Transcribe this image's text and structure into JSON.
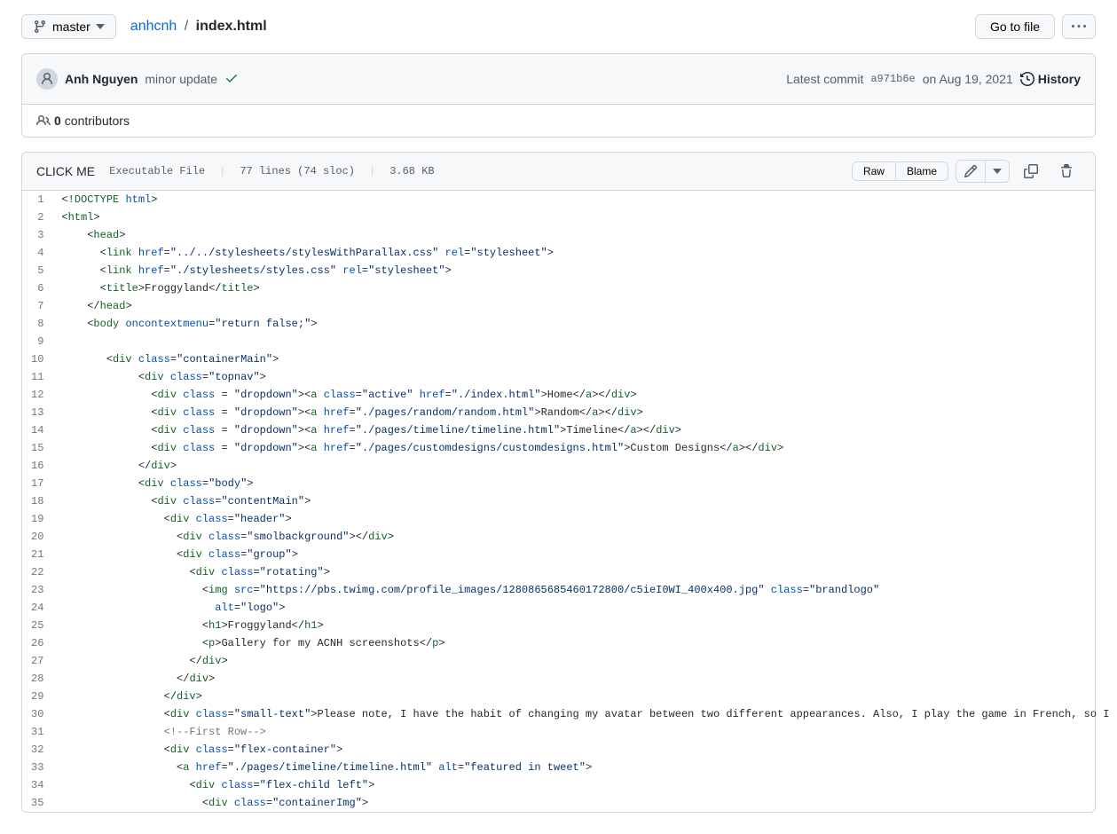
{
  "branch": "master",
  "breadcrumb": {
    "repo": "anhcnh",
    "sep": "/",
    "file": "index.html"
  },
  "go_to_file": "Go to file",
  "commit": {
    "author": "Anh Nguyen",
    "message": "minor update",
    "latest_label": "Latest commit",
    "sha": "a971b6e",
    "date": "on Aug 19, 2021",
    "history": "History"
  },
  "contributors": {
    "count": "0",
    "label": "contributors"
  },
  "file_info": {
    "clickme": "CLICK ME",
    "exec": "Executable File",
    "lines": "77 lines (74 sloc)",
    "size": "3.68 KB"
  },
  "actions": {
    "raw": "Raw",
    "blame": "Blame"
  },
  "code": [
    {
      "n": 1,
      "html": "<span class='pl-kos'>&lt;!</span><span class='pl-ent'>DOCTYPE</span> <span class='pl-e'>html</span><span class='pl-kos'>&gt;</span>"
    },
    {
      "n": 2,
      "html": "<span class='pl-kos'>&lt;</span><span class='pl-ent'>html</span><span class='pl-kos'>&gt;</span>"
    },
    {
      "n": 3,
      "html": "    <span class='pl-kos'>&lt;</span><span class='pl-ent'>head</span><span class='pl-kos'>&gt;</span>"
    },
    {
      "n": 4,
      "html": "      <span class='pl-kos'>&lt;</span><span class='pl-ent'>link</span> <span class='pl-e'>href</span>=<span class='pl-s'>\"../../stylesheets/stylesWithParallax.css\"</span> <span class='pl-e'>rel</span>=<span class='pl-s'>\"stylesheet\"</span><span class='pl-kos'>&gt;</span>"
    },
    {
      "n": 5,
      "html": "      <span class='pl-kos'>&lt;</span><span class='pl-ent'>link</span> <span class='pl-e'>href</span>=<span class='pl-s'>\"./stylesheets/styles.css\"</span> <span class='pl-e'>rel</span>=<span class='pl-s'>\"stylesheet\"</span><span class='pl-kos'>&gt;</span>"
    },
    {
      "n": 6,
      "html": "      <span class='pl-kos'>&lt;</span><span class='pl-ent'>title</span><span class='pl-kos'>&gt;</span>Froggyland<span class='pl-kos'>&lt;/</span><span class='pl-ent'>title</span><span class='pl-kos'>&gt;</span>"
    },
    {
      "n": 7,
      "html": "    <span class='pl-kos'>&lt;/</span><span class='pl-ent'>head</span><span class='pl-kos'>&gt;</span>"
    },
    {
      "n": 8,
      "html": "    <span class='pl-kos'>&lt;</span><span class='pl-ent'>body</span> <span class='pl-e'>oncontextmenu</span>=<span class='pl-s'>\"return false;\"</span><span class='pl-kos'>&gt;</span>"
    },
    {
      "n": 9,
      "html": ""
    },
    {
      "n": 10,
      "html": "       <span class='pl-kos'>&lt;</span><span class='pl-ent'>div</span> <span class='pl-e'>class</span>=<span class='pl-s'>\"containerMain\"</span><span class='pl-kos'>&gt;</span>"
    },
    {
      "n": 11,
      "html": "            <span class='pl-kos'>&lt;</span><span class='pl-ent'>div</span> <span class='pl-e'>class</span>=<span class='pl-s'>\"topnav\"</span><span class='pl-kos'>&gt;</span>"
    },
    {
      "n": 12,
      "html": "              <span class='pl-kos'>&lt;</span><span class='pl-ent'>div</span> <span class='pl-e'>class</span> = <span class='pl-s'>\"dropdown\"</span><span class='pl-kos'>&gt;</span><span class='pl-kos'>&lt;</span><span class='pl-ent'>a</span> <span class='pl-e'>class</span>=<span class='pl-s'>\"active\"</span> <span class='pl-e'>href</span>=<span class='pl-s'>\"./index.html\"</span><span class='pl-kos'>&gt;</span>Home<span class='pl-kos'>&lt;/</span><span class='pl-ent'>a</span><span class='pl-kos'>&gt;</span><span class='pl-kos'>&lt;/</span><span class='pl-ent'>div</span><span class='pl-kos'>&gt;</span>"
    },
    {
      "n": 13,
      "html": "              <span class='pl-kos'>&lt;</span><span class='pl-ent'>div</span> <span class='pl-e'>class</span> = <span class='pl-s'>\"dropdown\"</span><span class='pl-kos'>&gt;</span><span class='pl-kos'>&lt;</span><span class='pl-ent'>a</span> <span class='pl-e'>href</span>=<span class='pl-s'>\"./pages/random/random.html\"</span><span class='pl-kos'>&gt;</span>Random<span class='pl-kos'>&lt;/</span><span class='pl-ent'>a</span><span class='pl-kos'>&gt;</span><span class='pl-kos'>&lt;/</span><span class='pl-ent'>div</span><span class='pl-kos'>&gt;</span>"
    },
    {
      "n": 14,
      "html": "              <span class='pl-kos'>&lt;</span><span class='pl-ent'>div</span> <span class='pl-e'>class</span> = <span class='pl-s'>\"dropdown\"</span><span class='pl-kos'>&gt;</span><span class='pl-kos'>&lt;</span><span class='pl-ent'>a</span> <span class='pl-e'>href</span>=<span class='pl-s'>\"./pages/timeline/timeline.html\"</span><span class='pl-kos'>&gt;</span>Timeline<span class='pl-kos'>&lt;/</span><span class='pl-ent'>a</span><span class='pl-kos'>&gt;</span><span class='pl-kos'>&lt;/</span><span class='pl-ent'>div</span><span class='pl-kos'>&gt;</span>"
    },
    {
      "n": 15,
      "html": "              <span class='pl-kos'>&lt;</span><span class='pl-ent'>div</span> <span class='pl-e'>class</span> = <span class='pl-s'>\"dropdown\"</span><span class='pl-kos'>&gt;</span><span class='pl-kos'>&lt;</span><span class='pl-ent'>a</span> <span class='pl-e'>href</span>=<span class='pl-s'>\"./pages/customdesigns/customdesigns.html\"</span><span class='pl-kos'>&gt;</span>Custom Designs<span class='pl-kos'>&lt;/</span><span class='pl-ent'>a</span><span class='pl-kos'>&gt;</span><span class='pl-kos'>&lt;/</span><span class='pl-ent'>div</span><span class='pl-kos'>&gt;</span>"
    },
    {
      "n": 16,
      "html": "            <span class='pl-kos'>&lt;/</span><span class='pl-ent'>div</span><span class='pl-kos'>&gt;</span>"
    },
    {
      "n": 17,
      "html": "            <span class='pl-kos'>&lt;</span><span class='pl-ent'>div</span> <span class='pl-e'>class</span>=<span class='pl-s'>\"body\"</span><span class='pl-kos'>&gt;</span>"
    },
    {
      "n": 18,
      "html": "              <span class='pl-kos'>&lt;</span><span class='pl-ent'>div</span> <span class='pl-e'>class</span>=<span class='pl-s'>\"contentMain\"</span><span class='pl-kos'>&gt;</span>"
    },
    {
      "n": 19,
      "html": "                <span class='pl-kos'>&lt;</span><span class='pl-ent'>div</span> <span class='pl-e'>class</span>=<span class='pl-s'>\"header\"</span><span class='pl-kos'>&gt;</span>"
    },
    {
      "n": 20,
      "html": "                  <span class='pl-kos'>&lt;</span><span class='pl-ent'>div</span> <span class='pl-e'>class</span>=<span class='pl-s'>\"smolbackground\"</span><span class='pl-kos'>&gt;</span><span class='pl-kos'>&lt;/</span><span class='pl-ent'>div</span><span class='pl-kos'>&gt;</span>"
    },
    {
      "n": 21,
      "html": "                  <span class='pl-kos'>&lt;</span><span class='pl-ent'>div</span> <span class='pl-e'>class</span>=<span class='pl-s'>\"group\"</span><span class='pl-kos'>&gt;</span>"
    },
    {
      "n": 22,
      "html": "                    <span class='pl-kos'>&lt;</span><span class='pl-ent'>div</span> <span class='pl-e'>class</span>=<span class='pl-s'>\"rotating\"</span><span class='pl-kos'>&gt;</span>"
    },
    {
      "n": 23,
      "html": "                      <span class='pl-kos'>&lt;</span><span class='pl-ent'>img</span> <span class='pl-e'>src</span>=<span class='pl-s'>\"https://pbs.twimg.com/profile_images/1280865685460172800/c5ieI0WI_400x400.jpg\"</span> <span class='pl-e'>class</span>=<span class='pl-s'>\"brandlogo\"</span>"
    },
    {
      "n": 24,
      "html": "                        <span class='pl-e'>alt</span>=<span class='pl-s'>\"logo\"</span><span class='pl-kos'>&gt;</span>"
    },
    {
      "n": 25,
      "html": "                      <span class='pl-kos'>&lt;</span><span class='pl-ent'>h1</span><span class='pl-kos'>&gt;</span>Froggyland<span class='pl-kos'>&lt;/</span><span class='pl-ent'>h1</span><span class='pl-kos'>&gt;</span>"
    },
    {
      "n": 26,
      "html": "                      <span class='pl-kos'>&lt;</span><span class='pl-ent'>p</span><span class='pl-kos'>&gt;</span>Gallery for my ACNH screenshots<span class='pl-kos'>&lt;/</span><span class='pl-ent'>p</span><span class='pl-kos'>&gt;</span>"
    },
    {
      "n": 27,
      "html": "                    <span class='pl-kos'>&lt;/</span><span class='pl-ent'>div</span><span class='pl-kos'>&gt;</span>"
    },
    {
      "n": 28,
      "html": "                  <span class='pl-kos'>&lt;/</span><span class='pl-ent'>div</span><span class='pl-kos'>&gt;</span>"
    },
    {
      "n": 29,
      "html": "                <span class='pl-kos'>&lt;/</span><span class='pl-ent'>div</span><span class='pl-kos'>&gt;</span>"
    },
    {
      "n": 30,
      "html": "                <span class='pl-kos'>&lt;</span><span class='pl-ent'>div</span> <span class='pl-e'>class</span>=<span class='pl-s'>\"small-text\"</span><span class='pl-kos'>&gt;</span>Please note, I have the habit of changing my avatar between two different appearances. Also, I play the game in French, so I refer to v"
    },
    {
      "n": 31,
      "html": "                <span class='pl-c'>&lt;!--First Row--&gt;</span>"
    },
    {
      "n": 32,
      "html": "                <span class='pl-kos'>&lt;</span><span class='pl-ent'>div</span> <span class='pl-e'>class</span>=<span class='pl-s'>\"flex-container\"</span><span class='pl-kos'>&gt;</span>"
    },
    {
      "n": 33,
      "html": "                  <span class='pl-kos'>&lt;</span><span class='pl-ent'>a</span> <span class='pl-e'>href</span>=<span class='pl-s'>\"./pages/timeline/timeline.html\"</span> <span class='pl-e'>alt</span>=<span class='pl-s'>\"featured in tweet\"</span><span class='pl-kos'>&gt;</span>"
    },
    {
      "n": 34,
      "html": "                    <span class='pl-kos'>&lt;</span><span class='pl-ent'>div</span> <span class='pl-e'>class</span>=<span class='pl-s'>\"flex-child left\"</span><span class='pl-kos'>&gt;</span>"
    },
    {
      "n": 35,
      "html": "                      <span class='pl-kos'>&lt;</span><span class='pl-ent'>div</span> <span class='pl-e'>class</span>=<span class='pl-s'>\"containerImg\"</span><span class='pl-kos'>&gt;</span>"
    }
  ]
}
